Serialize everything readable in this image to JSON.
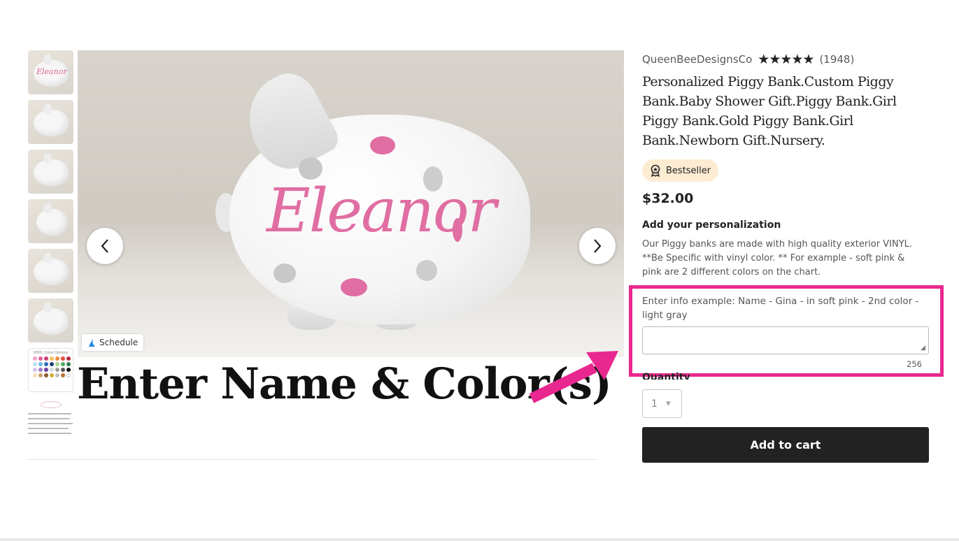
{
  "listing": {
    "shop_name": "QueenBeeDesignsCo",
    "rating_stars": "★★★★★",
    "review_count": "(1948)",
    "title": "Personalized Piggy Bank.Custom Piggy Bank.Baby Shower Gift.Piggy Bank.Girl Piggy Bank.Gold Piggy Bank.Girl Bank.Newborn Gift.Nursery.",
    "badge": "Bestseller",
    "price": "$32.00"
  },
  "gallery": {
    "main_image_name_text": "Eleanor",
    "schedule_label": "Schedule",
    "thumbnail_name_text": "Eleanor",
    "chart_thumbnail_title": "VINYL Color Options",
    "prev_icon": "chevron-left-icon",
    "next_icon": "chevron-right-icon"
  },
  "annotation": {
    "text": "Enter Name & Color(s)",
    "highlight_color": "#e8288f"
  },
  "personalization": {
    "heading": "Add your personalization",
    "description": "Our Piggy banks are made with high quality exterior VINYL. **Be Specific with vinyl color. ** For example - soft pink & pink are 2 different colors on the chart.",
    "field_label": "Enter info example: Name - Gina - in soft pink - 2nd color - light gray",
    "field_value": "",
    "char_count": "256"
  },
  "quantity": {
    "label": "Quantity",
    "selected": "1"
  },
  "cart": {
    "button_label": "Add to cart"
  },
  "colors": {
    "accent_pink": "#e8288f",
    "button_dark": "#222222",
    "badge_bg": "#fdebd2"
  }
}
